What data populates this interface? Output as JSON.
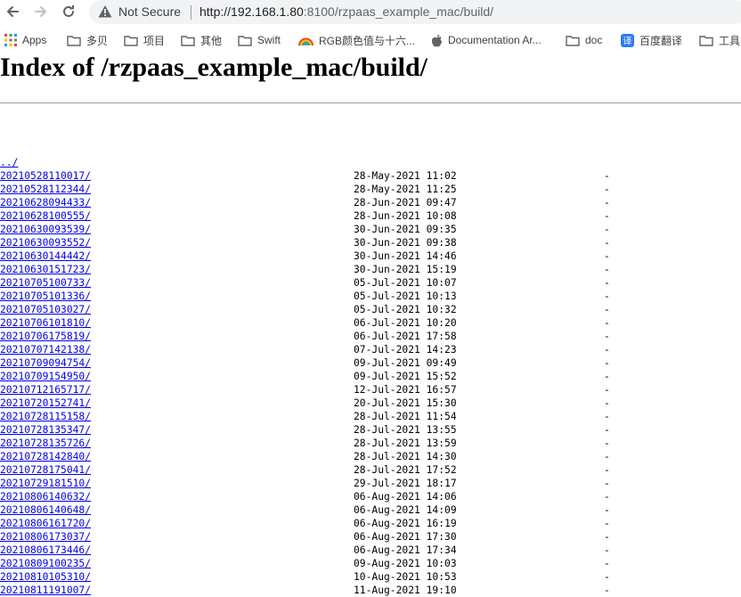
{
  "browser": {
    "security_label": "Not Secure",
    "url_host": "192.168.1.80",
    "url_path": ":8100/rzpaas_example_mac/build/",
    "bookmarks": [
      {
        "label": "Apps",
        "icon": "apps-grid-icon"
      },
      {
        "label": "多贝",
        "icon": "folder-icon"
      },
      {
        "label": "项目",
        "icon": "folder-icon"
      },
      {
        "label": "其他",
        "icon": "folder-icon"
      },
      {
        "label": "Swift",
        "icon": "folder-icon"
      },
      {
        "label": "RGB颜色值与十六...",
        "icon": "rainbow-icon"
      },
      {
        "label": "Documentation Ar...",
        "icon": "apple-icon"
      },
      {
        "label": "doc",
        "icon": "folder-icon"
      },
      {
        "label": "百度翻译",
        "icon": "translate-icon"
      },
      {
        "label": "工具",
        "icon": "folder-icon"
      }
    ],
    "colors": {
      "link": "#0000ee",
      "omnibox_bg": "#f1f3f4"
    }
  },
  "page": {
    "title": "Index of /rzpaas_example_mac/build/",
    "parent_link": "../",
    "entries": [
      {
        "name": "20210528110017/",
        "date": "28-May-2021 11:02",
        "size": "-"
      },
      {
        "name": "20210528112344/",
        "date": "28-May-2021 11:25",
        "size": "-"
      },
      {
        "name": "20210628094433/",
        "date": "28-Jun-2021 09:47",
        "size": "-"
      },
      {
        "name": "20210628100555/",
        "date": "28-Jun-2021 10:08",
        "size": "-"
      },
      {
        "name": "20210630093539/",
        "date": "30-Jun-2021 09:35",
        "size": "-"
      },
      {
        "name": "20210630093552/",
        "date": "30-Jun-2021 09:38",
        "size": "-"
      },
      {
        "name": "20210630144442/",
        "date": "30-Jun-2021 14:46",
        "size": "-"
      },
      {
        "name": "20210630151723/",
        "date": "30-Jun-2021 15:19",
        "size": "-"
      },
      {
        "name": "20210705100733/",
        "date": "05-Jul-2021 10:07",
        "size": "-"
      },
      {
        "name": "20210705101336/",
        "date": "05-Jul-2021 10:13",
        "size": "-"
      },
      {
        "name": "20210705103027/",
        "date": "05-Jul-2021 10:32",
        "size": "-"
      },
      {
        "name": "20210706101810/",
        "date": "06-Jul-2021 10:20",
        "size": "-"
      },
      {
        "name": "20210706175819/",
        "date": "06-Jul-2021 17:58",
        "size": "-"
      },
      {
        "name": "20210707142138/",
        "date": "07-Jul-2021 14:23",
        "size": "-"
      },
      {
        "name": "20210709094754/",
        "date": "09-Jul-2021 09:49",
        "size": "-"
      },
      {
        "name": "20210709154950/",
        "date": "09-Jul-2021 15:52",
        "size": "-"
      },
      {
        "name": "20210712165717/",
        "date": "12-Jul-2021 16:57",
        "size": "-"
      },
      {
        "name": "20210720152741/",
        "date": "20-Jul-2021 15:30",
        "size": "-"
      },
      {
        "name": "20210728115158/",
        "date": "28-Jul-2021 11:54",
        "size": "-"
      },
      {
        "name": "20210728135347/",
        "date": "28-Jul-2021 13:55",
        "size": "-"
      },
      {
        "name": "20210728135726/",
        "date": "28-Jul-2021 13:59",
        "size": "-"
      },
      {
        "name": "20210728142840/",
        "date": "28-Jul-2021 14:30",
        "size": "-"
      },
      {
        "name": "20210728175041/",
        "date": "28-Jul-2021 17:52",
        "size": "-"
      },
      {
        "name": "20210729181510/",
        "date": "29-Jul-2021 18:17",
        "size": "-"
      },
      {
        "name": "20210806140632/",
        "date": "06-Aug-2021 14:06",
        "size": "-"
      },
      {
        "name": "20210806140648/",
        "date": "06-Aug-2021 14:09",
        "size": "-"
      },
      {
        "name": "20210806161720/",
        "date": "06-Aug-2021 16:19",
        "size": "-"
      },
      {
        "name": "20210806173037/",
        "date": "06-Aug-2021 17:30",
        "size": "-"
      },
      {
        "name": "20210806173446/",
        "date": "06-Aug-2021 17:34",
        "size": "-"
      },
      {
        "name": "20210809100235/",
        "date": "09-Aug-2021 10:03",
        "size": "-"
      },
      {
        "name": "20210810105310/",
        "date": "10-Aug-2021 10:53",
        "size": "-"
      },
      {
        "name": "20210811191007/",
        "date": "11-Aug-2021 19:10",
        "size": "-"
      }
    ]
  }
}
